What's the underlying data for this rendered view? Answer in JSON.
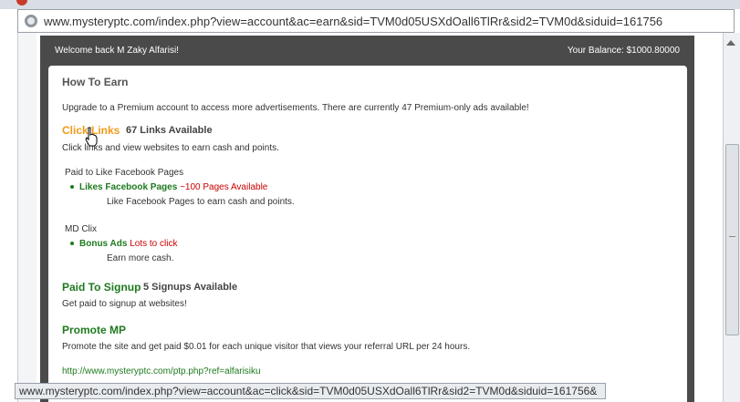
{
  "browser": {
    "url": "www.mysteryptc.com/index.php?view=account&ac=earn&sid=TVM0d05USXdOall6TlRr&sid2=TVM0d&siduid=161756",
    "status_url": "www.mysteryptc.com/index.php?view=account&ac=click&sid=TVM0d05USXdOall6TlRr&sid2=TVM0d&siduid=161756&"
  },
  "header": {
    "welcome": "Welcome back M Zaky Alfarisi!",
    "balance": "Your Balance: $1000.80000"
  },
  "main": {
    "title": "How To Earn",
    "upgrade_text": "Upgrade to a Premium account to access more advertisements. There are currently 47 Premium-only ads available!",
    "click_links": {
      "label": "Click Links",
      "count": "67 Links Available",
      "desc": "Click links and view websites to earn cash and points."
    },
    "facebook": {
      "section": "Paid to Like Facebook Pages",
      "item_label": "Likes Facebook Pages",
      "item_extra": "~100 Pages Available",
      "item_desc": "Like Facebook Pages to earn cash and points."
    },
    "mdclix": {
      "section": "MD Clix",
      "item_label": "Bonus Ads",
      "item_extra": "Lots to click",
      "item_desc": "Earn more cash."
    },
    "signup": {
      "label": "Paid To Signup",
      "count": "5 Signups Available",
      "desc": "Get paid to signup at websites!"
    },
    "promote": {
      "label": "Promote MP",
      "desc": "Promote the site and get paid $0.01 for each unique visitor that views your referral URL per 24 hours.",
      "ref_url": "http://www.mysteryptc.com/ptp.php?ref=alfarisiku"
    }
  },
  "icons": {
    "address_icon": "globe-icon",
    "cursor": "hand-pointer-icon"
  },
  "colors": {
    "orange": "#f09a1a",
    "green": "#1e7a1e",
    "red": "#cc0000",
    "site_bg": "#4a4a4a"
  }
}
